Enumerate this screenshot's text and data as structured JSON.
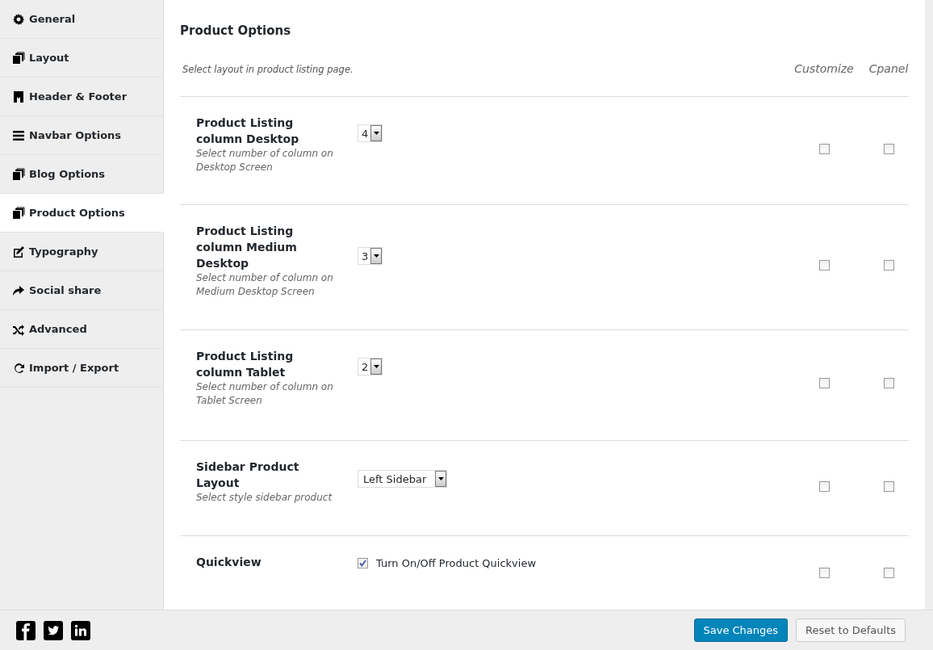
{
  "sidebar": {
    "items": [
      {
        "label": "General",
        "selected": false
      },
      {
        "label": "Layout",
        "selected": false
      },
      {
        "label": "Header & Footer",
        "selected": false
      },
      {
        "label": "Navbar Options",
        "selected": false
      },
      {
        "label": "Blog Options",
        "selected": false
      },
      {
        "label": "Product Options",
        "selected": true
      },
      {
        "label": "Typography",
        "selected": false
      },
      {
        "label": "Social share",
        "selected": false
      },
      {
        "label": "Advanced",
        "selected": false
      },
      {
        "label": "Import / Export",
        "selected": false
      }
    ]
  },
  "section": {
    "title": "Product Options",
    "subtitle": "Select layout in product listing page.",
    "column_headers": [
      "Customize",
      "Cpanel"
    ]
  },
  "options": [
    {
      "kind": "select",
      "label": "Product Listing column Desktop",
      "description": "Select number of column on Desktop Screen",
      "value": "4",
      "customize": false,
      "cpanel": false
    },
    {
      "kind": "select",
      "label": "Product Listing column Medium Desktop",
      "description": "Select number of column on Medium Desktop Screen",
      "value": "3",
      "customize": false,
      "cpanel": false
    },
    {
      "kind": "select",
      "label": "Product Listing column Tablet",
      "description": "Select number of column on Tablet Screen",
      "value": "2",
      "customize": false,
      "cpanel": false
    },
    {
      "kind": "select_wide",
      "label": "Sidebar Product Layout",
      "description": "Select style sidebar product",
      "value": "Left Sidebar",
      "customize": false,
      "cpanel": false
    },
    {
      "kind": "checkbox",
      "label": "Quickview",
      "checkbox_label": "Turn On/Off Product Quickview",
      "checked": true,
      "customize": false,
      "cpanel": false
    }
  ],
  "footer": {
    "buttons": [
      {
        "label": "Save Changes",
        "kind": "primary"
      },
      {
        "label": "Reset to Defaults",
        "kind": "secondary"
      }
    ]
  }
}
